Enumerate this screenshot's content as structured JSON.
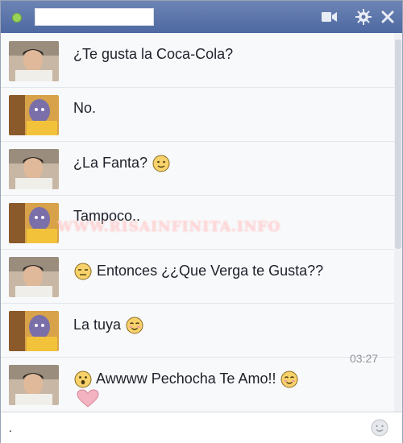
{
  "window": {
    "contact_name": "",
    "online_status_color": "#9ad35a"
  },
  "toolbar": {
    "icons": [
      "video-camera-icon",
      "gear-icon",
      "close-icon"
    ]
  },
  "messages": [
    {
      "sender": "me",
      "avatar": "avatar-boy",
      "text": "¿Te gusta la Coca-Cola?",
      "emoji_before": "",
      "emoji_after": ""
    },
    {
      "sender": "friend",
      "avatar": "avatar-girl",
      "text": "No.",
      "emoji_before": "",
      "emoji_after": ""
    },
    {
      "sender": "me",
      "avatar": "avatar-boy",
      "text": "¿La Fanta?",
      "emoji_before": "",
      "emoji_after": "smile-emoji"
    },
    {
      "sender": "friend",
      "avatar": "avatar-girl",
      "text": "Tampoco..",
      "emoji_before": "",
      "emoji_after": ""
    },
    {
      "sender": "me",
      "avatar": "avatar-boy",
      "text": "Entonces ¿¿Que Verga te Gusta??",
      "emoji_before": "unamused-emoji",
      "emoji_after": ""
    },
    {
      "sender": "friend",
      "avatar": "avatar-girl",
      "text": "La tuya",
      "emoji_before": "",
      "emoji_after": "blush-emoji"
    },
    {
      "sender": "me",
      "avatar": "avatar-boy",
      "text": "Awwww Pechocha Te Amo!!",
      "emoji_before": "surprised-emoji",
      "emoji_after": "blush-emoji",
      "extra": "heart-icon"
    }
  ],
  "timestamp": "03:27",
  "watermark": "WWW.RISAINFINITA.INFO",
  "composer": {
    "value": ".",
    "placeholder": ""
  }
}
